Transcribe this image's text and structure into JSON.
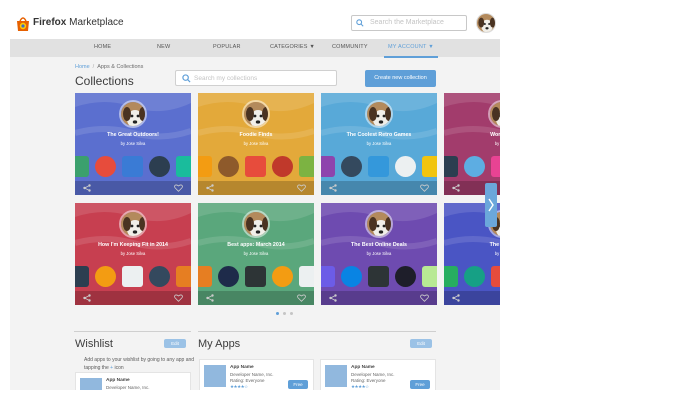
{
  "header": {
    "brand_bold": "Firefox",
    "brand_rest": " Marketplace",
    "search_placeholder": "Search the Marketplace"
  },
  "nav": [
    {
      "label": "HOME"
    },
    {
      "label": "NEW"
    },
    {
      "label": "POPULAR"
    },
    {
      "label": "CATEGORIES ▼"
    },
    {
      "label": "COMMUNITY"
    },
    {
      "label": "MY ACCOUNT ▼"
    }
  ],
  "breadcrumb": {
    "home": "Home",
    "sep": "/",
    "current": "Apps & Collections"
  },
  "page": {
    "title": "Collections",
    "search_placeholder": "Search my collections",
    "create_button": "Create new collection"
  },
  "collections": [
    {
      "title": "The Great Outdoors!",
      "byline": "by Jose Silva",
      "color": "#5b6fcf"
    },
    {
      "title": "Foodie Finds",
      "byline": "by Jose Silva",
      "color": "#e3a93a"
    },
    {
      "title": "The Coolest Retro Games",
      "byline": "by Jose Silva",
      "color": "#58a9d8"
    },
    {
      "title": "Workflow",
      "byline": "by Jose",
      "color": "#a23c6c"
    },
    {
      "title": "How I'm Keeping Fit in 2014",
      "byline": "by Jose Silva",
      "color": "#c73f50"
    },
    {
      "title": "Best apps: March 2014",
      "byline": "by Jose Silva",
      "color": "#5aa77c"
    },
    {
      "title": "The Best Online Deals",
      "byline": "by Jose Silva",
      "color": "#6e4bb0"
    },
    {
      "title": "The Great",
      "byline": "by Jose",
      "color": "#4a55c4"
    }
  ],
  "wishlist": {
    "title": "Wishlist",
    "edit": "Edit",
    "desc_before": "Add apps to your wishlist by going to any app and tapping the",
    "plus": "+",
    "desc_after": "icon",
    "app": {
      "name": "App Name",
      "dev": "Developer Name, Inc."
    }
  },
  "myapps": {
    "title": "My Apps",
    "edit": "Edit",
    "apps": [
      {
        "name": "App Name",
        "dev": "Developer Name, Inc.",
        "rating": "Rating: Everyone",
        "stars": "★★★★☆",
        "button": "Free"
      },
      {
        "name": "App Name",
        "dev": "Developer Name, Inc.",
        "rating": "Rating: Everyone",
        "stars": "★★★★☆",
        "button": "Free"
      }
    ]
  },
  "colors": {
    "accent": "#5f9fd8",
    "nav_bg": "#e1e1e1",
    "page_bg": "#f3f3f3"
  }
}
